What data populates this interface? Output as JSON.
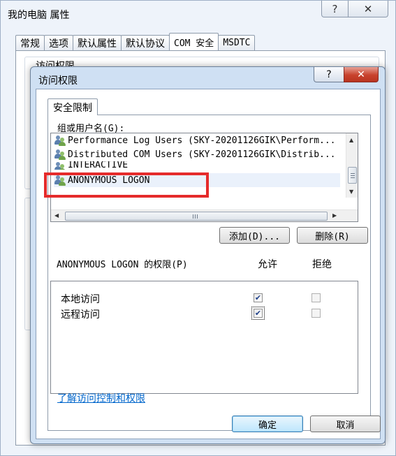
{
  "background_window": {
    "title": "我的电脑 属性",
    "help_glyph": "?",
    "close_glyph": "✕",
    "tabs": [
      {
        "label": "常规",
        "mono": false
      },
      {
        "label": "选项",
        "mono": false
      },
      {
        "label": "默认属性",
        "mono": false
      },
      {
        "label": "默认协议",
        "mono": false
      },
      {
        "label": "COM 安全",
        "mono": true
      },
      {
        "label": "MSDTC",
        "mono": true
      }
    ],
    "active_tab": "COM 安全",
    "group_label": "访问权限"
  },
  "dialog": {
    "title": "访问权限",
    "help_glyph": "?",
    "close_glyph": "✕",
    "tab": "安全限制",
    "users_label": "组或用户名(G):",
    "users": [
      {
        "name": "Performance Log Users (SKY-20201126GIK\\Perform..."
      },
      {
        "name": "Distributed COM Users (SKY-20201126GIK\\Distrib..."
      },
      {
        "name": "INTERACTIVE"
      },
      {
        "name": "ANONYMOUS LOGON"
      }
    ],
    "selected_user": "ANONYMOUS LOGON",
    "buttons": {
      "add": "添加(D)...",
      "remove": "删除(R)",
      "ok": "确定",
      "cancel": "取消"
    },
    "permissions_label": "ANONYMOUS LOGON 的权限(P)",
    "allow_header": "允许",
    "deny_header": "拒绝",
    "permissions": [
      {
        "name": "本地访问",
        "allow": true,
        "deny": false
      },
      {
        "name": "远程访问",
        "allow": true,
        "deny": false
      }
    ],
    "link": "了解访问控制和权限"
  },
  "colors": {
    "highlight_box": "#e52b2b",
    "link": "#0066cc",
    "close_button": "#c8422d"
  }
}
